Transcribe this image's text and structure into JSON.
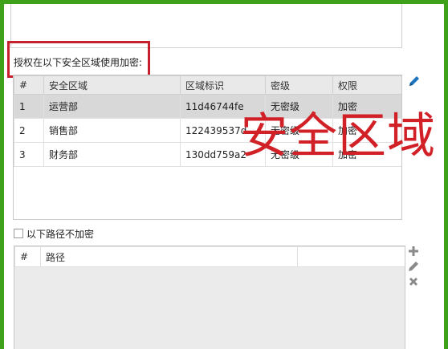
{
  "section": {
    "label": "授权在以下安全区域使用加密:"
  },
  "zone_table": {
    "columns": [
      "#",
      "安全区域",
      "区域标识",
      "密级",
      "权限"
    ],
    "rows": [
      {
        "no": "1",
        "zone": "运营部",
        "id": "11d46744fe",
        "level": "无密级",
        "permission": "加密"
      },
      {
        "no": "2",
        "zone": "销售部",
        "id": "122439537d",
        "level": "无密级",
        "permission": "加密"
      },
      {
        "no": "3",
        "zone": "财务部",
        "id": "130dd759a2",
        "level": "无密级",
        "permission": "加密"
      }
    ],
    "selected_row": 1
  },
  "overlay": {
    "big_label": "安全区域"
  },
  "exclude": {
    "checkbox_label": "以下路径不加密",
    "checked": false
  },
  "path_table": {
    "columns": [
      "#",
      "路径",
      ""
    ]
  },
  "icons": {
    "edit_zone": "pencil-icon",
    "add_path": "plus-icon",
    "edit_path": "pencil-icon",
    "remove_path": "close-icon"
  },
  "colors": {
    "frame": "#3fa01a",
    "highlight": "#c6202d",
    "accent_blue": "#1e73be",
    "icon_gray": "#8a8a8a"
  }
}
